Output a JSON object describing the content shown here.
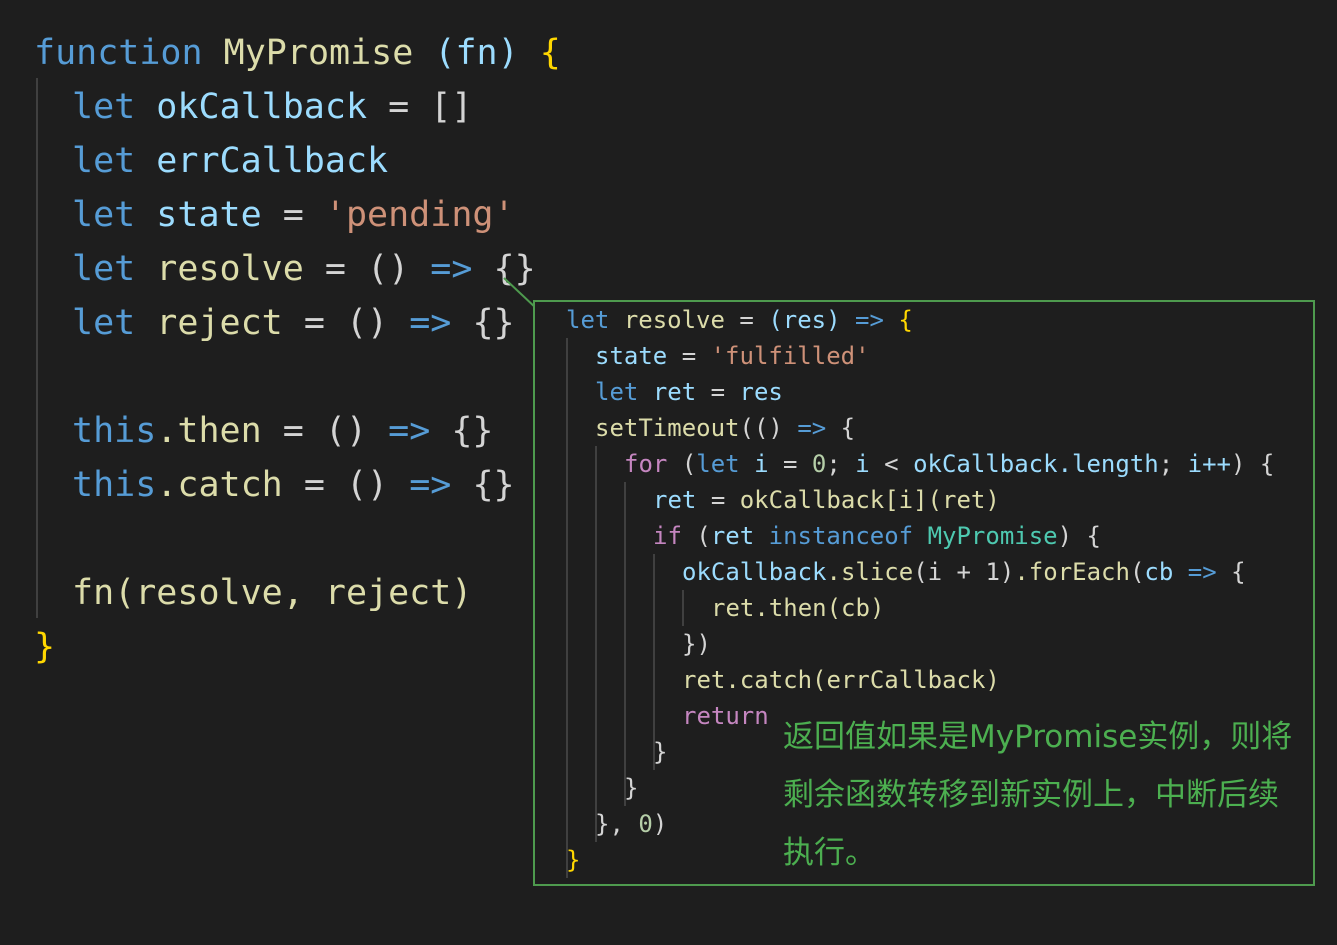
{
  "main_code": {
    "l1": {
      "kw": "function",
      "name": "MyPromise",
      "params": "(fn)",
      "brace": "{"
    },
    "l2": {
      "kw": "let",
      "name": "okCallback",
      "op": "=",
      "val": "[]"
    },
    "l3": {
      "kw": "let",
      "name": "errCallback"
    },
    "l4": {
      "kw": "let",
      "name": "state",
      "op": "=",
      "val": "'pending'"
    },
    "l5": {
      "kw": "let",
      "name": "resolve",
      "op": "=",
      "parens": "()",
      "arrow": "=>",
      "body": "{}"
    },
    "l6": {
      "kw": "let",
      "name": "reject",
      "op": "=",
      "parens": "()",
      "arrow": "=>",
      "body": "{}"
    },
    "l7": {
      "obj": "this",
      "prop": ".then",
      "op": "=",
      "parens": "()",
      "arrow": "=>",
      "body": "{}"
    },
    "l8": {
      "obj": "this",
      "prop": ".catch",
      "op": "=",
      "parens": "()",
      "arrow": "=>",
      "body": "{}"
    },
    "l9": {
      "fn": "fn",
      "args": "(resolve, reject)"
    },
    "l10": {
      "brace": "}"
    }
  },
  "popup_code": {
    "p1": {
      "kw": "let",
      "name": "resolve",
      "op": "=",
      "params": "(res)",
      "arrow": "=>",
      "brace": "{"
    },
    "p2": {
      "name": "state",
      "op": "=",
      "val": "'fulfilled'"
    },
    "p3": {
      "kw": "let",
      "name": "ret",
      "op": "=",
      "val": "res"
    },
    "p4": {
      "fn": "setTimeout",
      "open": "((",
      "close": ")",
      "arrow": "=>",
      "brace": "{"
    },
    "p5": {
      "kw": "for",
      "open": "(",
      "kw2": "let",
      "i": "i",
      "eq": "=",
      "zero": "0",
      "semi1": ";",
      "i2": "i",
      "lt": "<",
      "arr": "okCallback",
      "len": ".length",
      "semi2": ";",
      "inc": "i++",
      "close": ")",
      "brace": "{"
    },
    "p6": {
      "name": "ret",
      "op": "=",
      "expr": "okCallback[i](ret)"
    },
    "p7": {
      "kw": "if",
      "open": "(",
      "name": "ret",
      "op": "instanceof",
      "type": "MyPromise",
      "close": ")",
      "brace": "{"
    },
    "p8": {
      "arr": "okCallback",
      "slice": ".slice",
      "args": "(i + 1)",
      "each": ".forEach",
      "open": "(",
      "param": "cb",
      "arrow": "=>",
      "brace": "{"
    },
    "p9": {
      "expr": "ret.then(cb)"
    },
    "p10": {
      "text": "})"
    },
    "p11": {
      "expr": "ret.catch(errCallback)"
    },
    "p12": {
      "kw": "return"
    },
    "p13": {
      "text": "}"
    },
    "p14": {
      "text": "}"
    },
    "p15": {
      "text1": "},",
      "num": "0",
      "text2": ")"
    },
    "p16": {
      "text": "}"
    }
  },
  "note": {
    "text": "返回值如果是MyPromise实例，则将剩余函数转移到新实例上，中断后续执行。"
  },
  "colors": {
    "background": "#1e1e1e",
    "keyword": "#569cd6",
    "control": "#c586c0",
    "function": "#dcdcaa",
    "variable": "#9cdcfe",
    "string": "#ce9178",
    "number": "#b5cea8",
    "type": "#4ec9b0",
    "highlight_border": "#4e9a4e",
    "note_text": "#4caf50"
  }
}
